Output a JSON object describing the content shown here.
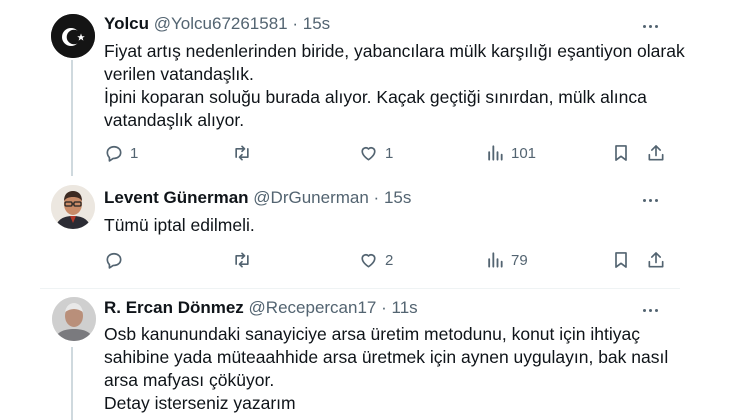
{
  "tweets": [
    {
      "name": "Yolcu",
      "handle": "@Yolcu67261581",
      "separator": "·",
      "time": "15s",
      "lines": [
        "Fiyat artış nedenlerinden biride, yabancılara mülk karşılığı eşantiyon olarak",
        "verilen vatandaşlık.",
        "İpini koparan soluğu burada alıyor. Kaçak geçtiği sınırdan, mülk alınca",
        "vatandaşlık alıyor."
      ],
      "replies": "1",
      "retweets": "",
      "likes": "1",
      "views": "101"
    },
    {
      "name": "Levent Günerman",
      "handle": "@DrGunerman",
      "separator": "·",
      "time": "15s",
      "lines": [
        "Tümü iptal edilmeli."
      ],
      "replies": "",
      "retweets": "",
      "likes": "2",
      "views": "79"
    },
    {
      "name": "R. Ercan Dönmez",
      "handle": "@Recepercan17",
      "separator": "·",
      "time": "11s",
      "lines": [
        "Osb kanunundaki  sanayiciye arsa üretim metodunu, konut için ihtiyaç",
        "sahibine yada müteaahhide arsa üretmek için aynen uygulayın, bak nasıl",
        "arsa mafyası çöküyor.",
        "Detay isterseniz yazarım"
      ]
    }
  ],
  "icons": {
    "reply": "reply-icon",
    "retweet": "retweet-icon",
    "like": "heart-icon",
    "views": "views-icon",
    "bookmark": "bookmark-icon",
    "share": "share-icon",
    "more": "more-icon"
  },
  "colors": {
    "text": "#0f1419",
    "secondary": "#536471",
    "divider": "#eff3f4",
    "thread_line": "#cfd9de"
  }
}
